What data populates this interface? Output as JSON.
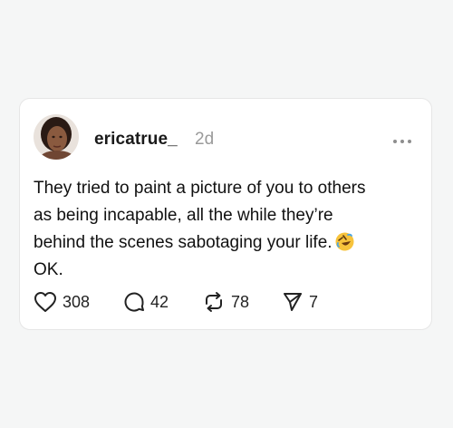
{
  "post": {
    "username": "ericatrue_",
    "timestamp": "2d",
    "text_lines": [
      "They tried to paint a picture of you to others",
      "as being incapable, all the while they’re",
      "behind the scenes sabotaging your life.",
      "OK."
    ],
    "emoji": "rolling-on-the-floor-laughing-emoji"
  },
  "actions": {
    "likes": "308",
    "replies": "42",
    "reposts": "78",
    "shares": "7"
  },
  "icons": {
    "avatar": "avatar-photo",
    "more": "more-horizontal-icon",
    "like": "heart-icon",
    "reply": "comment-icon",
    "repost": "repost-icon",
    "share": "send-icon"
  },
  "colors": {
    "background": "#f5f6f6",
    "card": "#ffffff",
    "text": "#111111",
    "muted": "#9a9a9a"
  }
}
